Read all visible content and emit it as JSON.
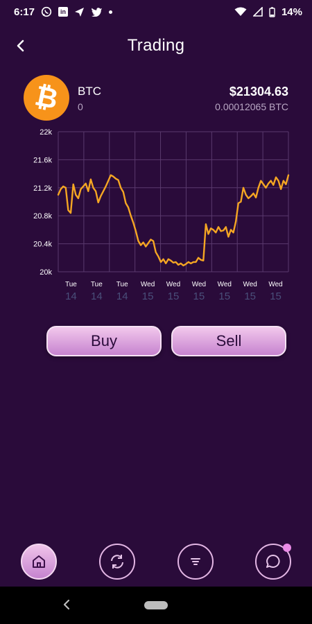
{
  "status_bar": {
    "time": "6:17",
    "battery": "14%",
    "linkedin_label": "in",
    "icons": [
      "whatsapp-icon",
      "linkedin-icon",
      "send-icon",
      "twitter-icon",
      "dot-icon",
      "wifi-icon",
      "signal-icon",
      "battery-icon"
    ]
  },
  "header": {
    "title": "Trading",
    "back_icon": "chevron-left-icon"
  },
  "coin": {
    "symbol": "BTC",
    "amount": "0",
    "price_usd": "$21304.63",
    "price_btc": "0.00012065 BTC",
    "logo_glyph": "₿",
    "logo_color": "#f7931a"
  },
  "chart_data": {
    "type": "line",
    "color": "#f5a623",
    "grid": true,
    "y_ticks": [
      "22k",
      "21.6k",
      "21.2k",
      "20.8k",
      "20.4k",
      "20k"
    ],
    "ylim": [
      20000,
      22000
    ],
    "x_ticks": [
      {
        "day": "Tue",
        "date": "14"
      },
      {
        "day": "Tue",
        "date": "14"
      },
      {
        "day": "Tue",
        "date": "14"
      },
      {
        "day": "Wed",
        "date": "15"
      },
      {
        "day": "Wed",
        "date": "15"
      },
      {
        "day": "Wed",
        "date": "15"
      },
      {
        "day": "Wed",
        "date": "15"
      },
      {
        "day": "Wed",
        "date": "15"
      },
      {
        "day": "Wed",
        "date": "15"
      }
    ],
    "values": [
      21100,
      21180,
      21220,
      21200,
      20880,
      20840,
      21250,
      21100,
      21050,
      21180,
      21220,
      21260,
      21150,
      21320,
      21200,
      21150,
      20990,
      21080,
      21150,
      21220,
      21300,
      21380,
      21360,
      21330,
      21310,
      21200,
      21140,
      20980,
      20920,
      20800,
      20700,
      20580,
      20440,
      20380,
      20420,
      20360,
      20410,
      20460,
      20440,
      20280,
      20220,
      20140,
      20180,
      20120,
      20180,
      20160,
      20130,
      20140,
      20100,
      20120,
      20090,
      20110,
      20140,
      20120,
      20140,
      20140,
      20200,
      20170,
      20160,
      20680,
      20540,
      20620,
      20600,
      20560,
      20640,
      20580,
      20590,
      20640,
      20500,
      20600,
      20560,
      20720,
      20980,
      21000,
      21200,
      21100,
      21050,
      21080,
      21120,
      21060,
      21200,
      21300,
      21250,
      21200,
      21260,
      21300,
      21240,
      21350,
      21300,
      21180,
      21300,
      21250,
      21380
    ]
  },
  "actions": {
    "buy_label": "Buy",
    "sell_label": "Sell"
  },
  "bottom_nav": {
    "items": [
      "home-icon",
      "exchange-icon",
      "orders-icon",
      "chat-icon"
    ],
    "active": "home-icon",
    "active_color": "#e0a5e0"
  },
  "system_nav": {
    "back_icon": "chevron-left-icon"
  }
}
